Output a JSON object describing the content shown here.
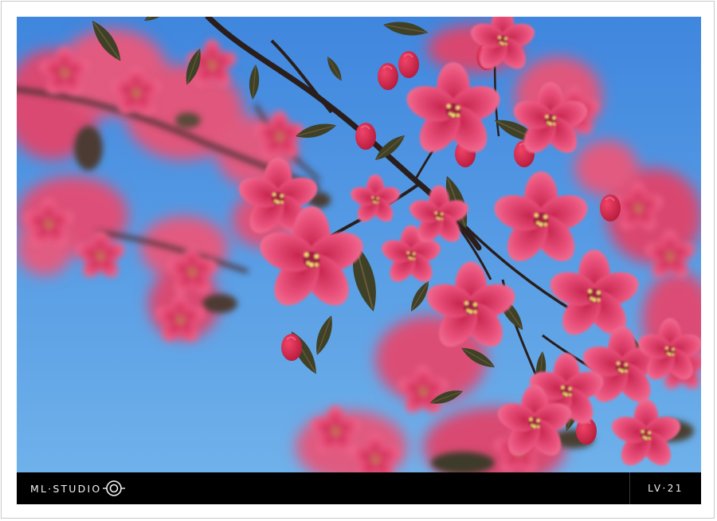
{
  "watermark": {
    "brand": "ML·STUDIO",
    "code": "LV·21"
  },
  "photo": {
    "subject": "flowering-crabapple-branch",
    "colors": {
      "sky_top": "#3f86de",
      "sky_bottom": "#6fb1ea",
      "blossom": "#e0406a",
      "blossom_dark": "#b82350",
      "blossom_light": "#f06f94",
      "leaf": "#3b3f2a",
      "branch": "#2a1e1c"
    }
  }
}
